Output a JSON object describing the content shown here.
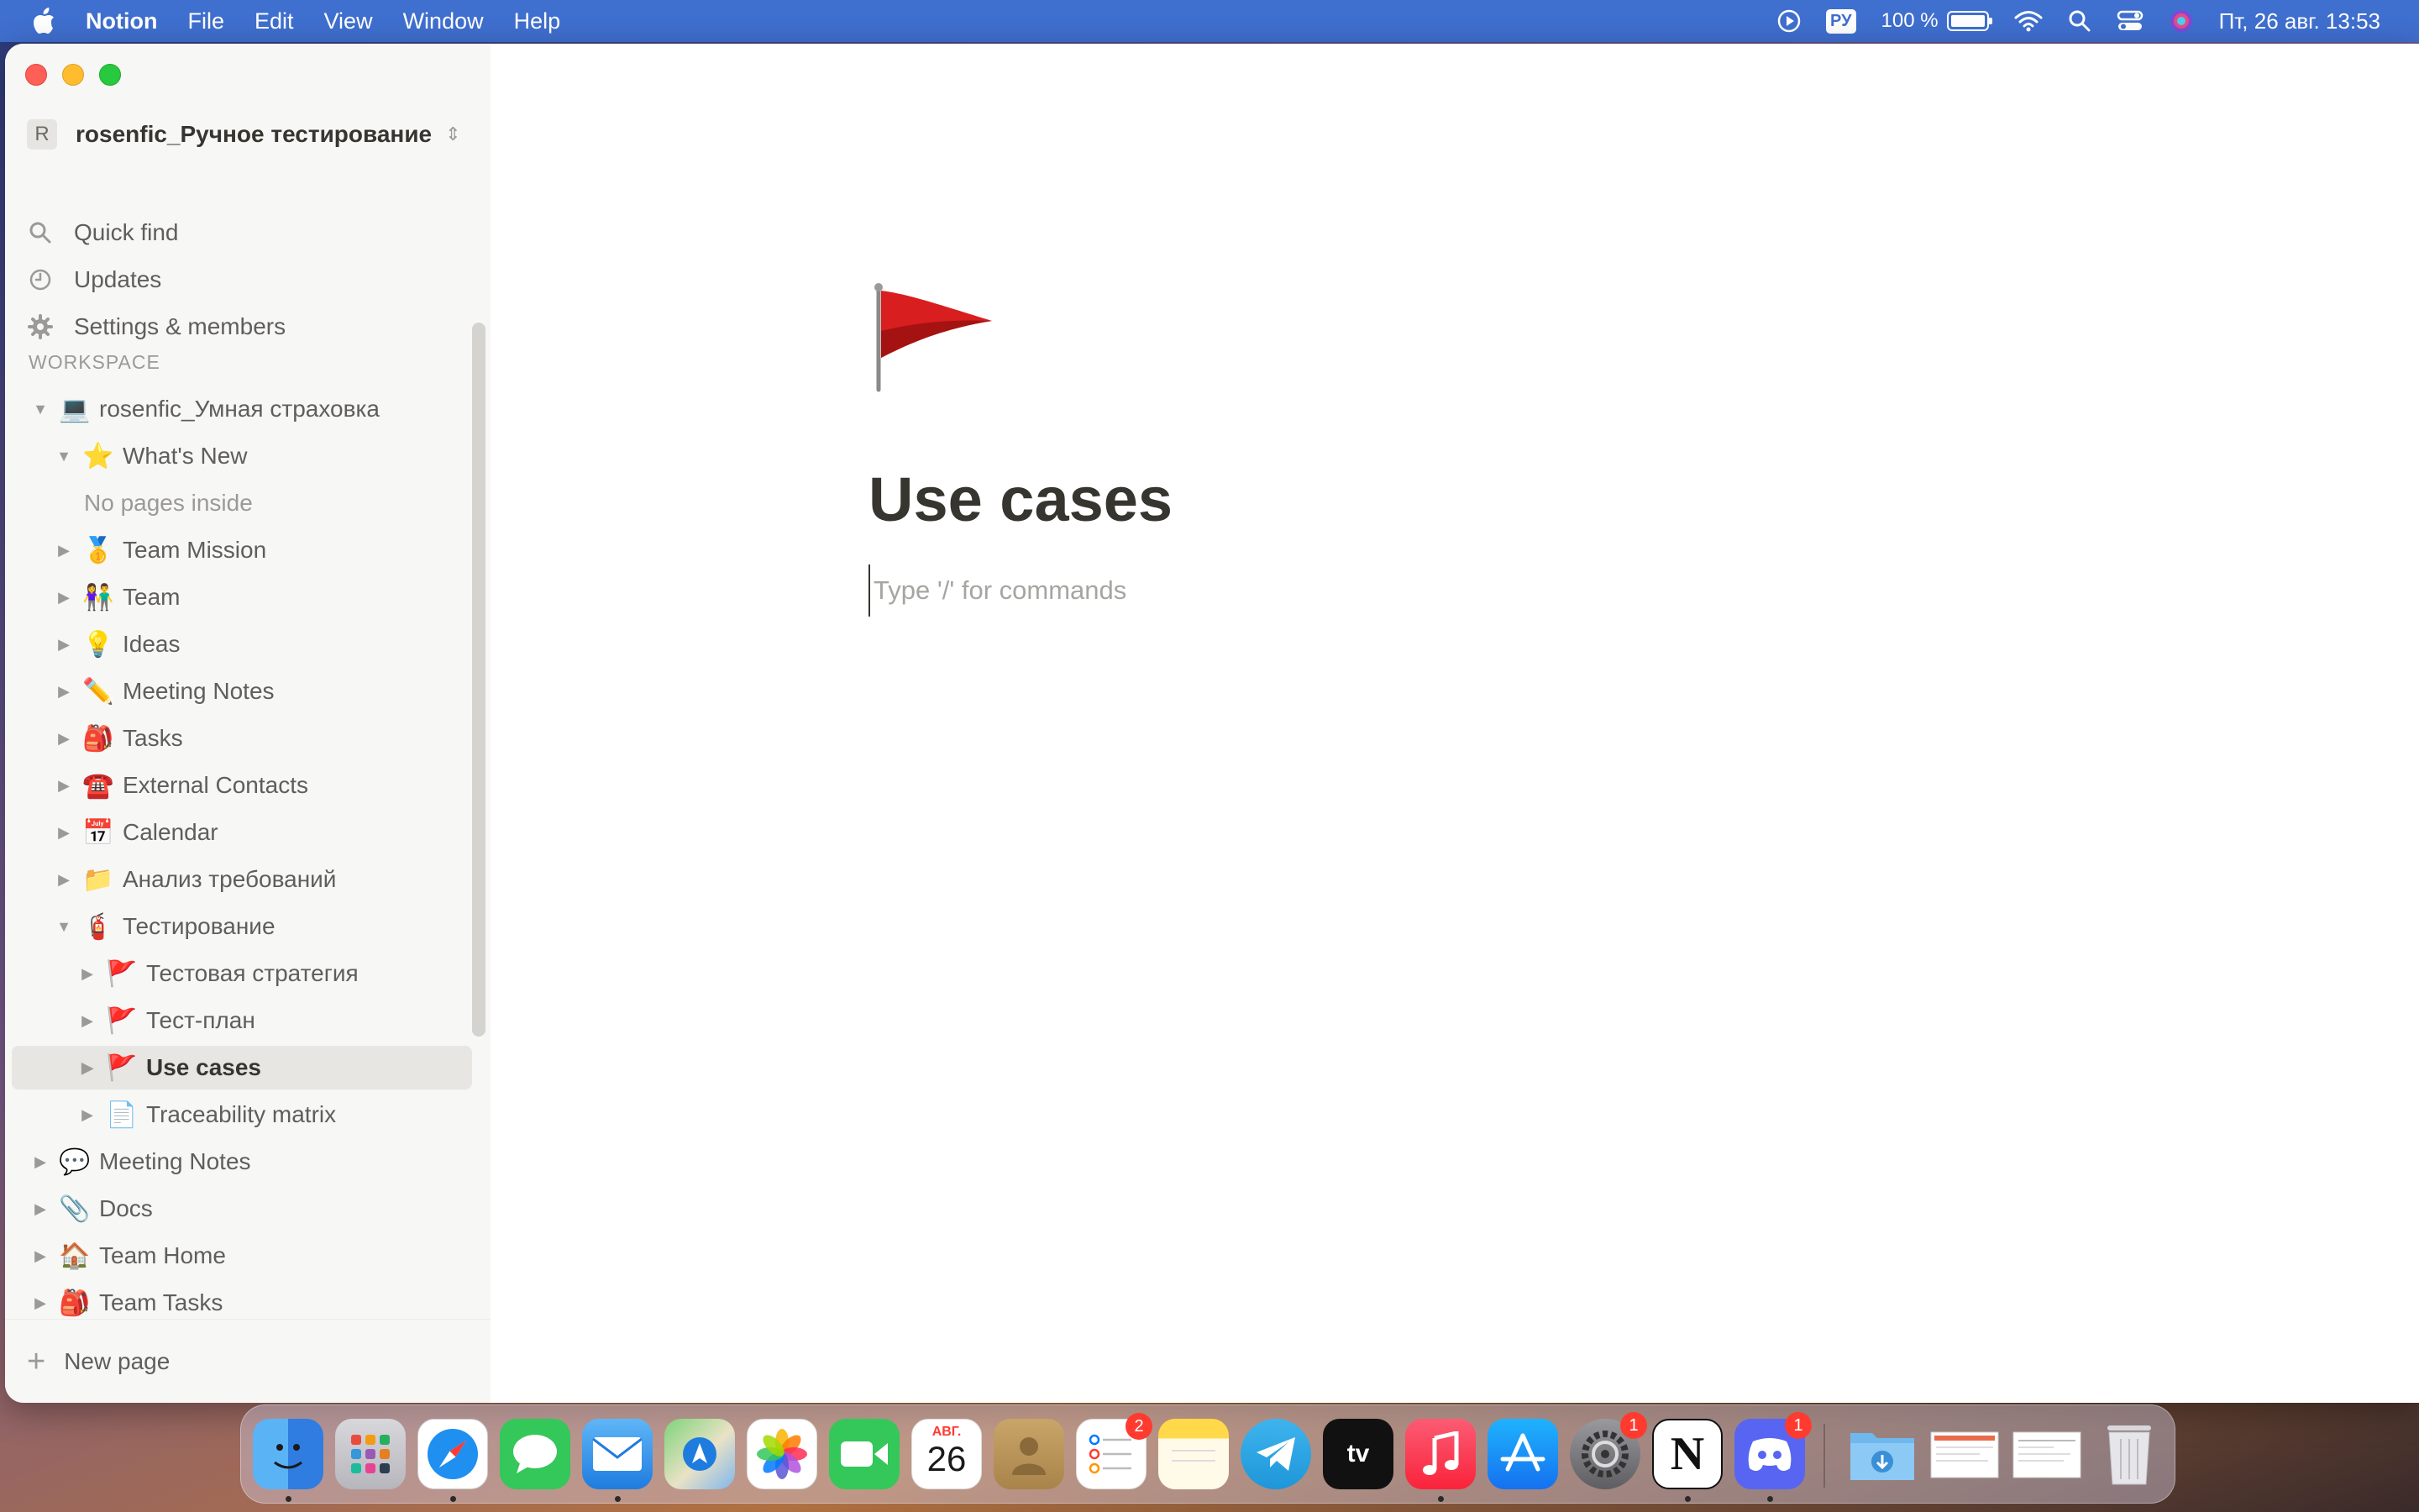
{
  "menubar": {
    "app_name": "Notion",
    "menus": [
      "File",
      "Edit",
      "View",
      "Window",
      "Help"
    ],
    "input_language": "РУ",
    "battery_percent": "100 %",
    "battery_level": 1.0,
    "clock": "Пт, 26 авг.  13:53"
  },
  "sidebar": {
    "workspace_avatar": "R",
    "workspace_name": "rosenfic_Ручное тестирование",
    "actions": [
      {
        "label": "Quick find",
        "icon": "search-icon"
      },
      {
        "label": "Updates",
        "icon": "clock-icon"
      },
      {
        "label": "Settings & members",
        "icon": "gear-icon"
      }
    ],
    "section_label": "WORKSPACE",
    "tree": [
      {
        "label": "rosenfic_Умная страховка",
        "emoji": "💻",
        "arrow": "▼"
      },
      {
        "label": "What's New",
        "emoji": "⭐",
        "arrow": "▼"
      },
      {
        "label": "No pages inside",
        "emoji": "",
        "arrow": ""
      },
      {
        "label": "Team Mission",
        "emoji": "🥇",
        "arrow": "▶"
      },
      {
        "label": "Team",
        "emoji": "👫",
        "arrow": "▶"
      },
      {
        "label": "Ideas",
        "emoji": "💡",
        "arrow": "▶"
      },
      {
        "label": "Meeting Notes",
        "emoji": "✏️",
        "arrow": "▶"
      },
      {
        "label": "Tasks",
        "emoji": "🎒",
        "arrow": "▶"
      },
      {
        "label": "External Contacts",
        "emoji": "☎️",
        "arrow": "▶"
      },
      {
        "label": "Calendar",
        "emoji": "📅",
        "arrow": "▶"
      },
      {
        "label": "Анализ требований",
        "emoji": "📁",
        "arrow": "▶"
      },
      {
        "label": "Тестирование",
        "emoji": "🧯",
        "arrow": "▼"
      },
      {
        "label": "Тестовая стратегия",
        "emoji": "🚩",
        "arrow": "▶"
      },
      {
        "label": "Тест-план",
        "emoji": "🚩",
        "arrow": "▶"
      },
      {
        "label": "Use cases",
        "emoji": "🚩",
        "arrow": "▶"
      },
      {
        "label": "Traceability matrix",
        "emoji": "📄",
        "arrow": "▶"
      },
      {
        "label": "Meeting Notes",
        "emoji": "💬",
        "arrow": "▶"
      },
      {
        "label": "Docs",
        "emoji": "📎",
        "arrow": "▶"
      },
      {
        "label": "Team Home",
        "emoji": "🏠",
        "arrow": "▶"
      },
      {
        "label": "Team Tasks",
        "emoji": "🎒",
        "arrow": "▶"
      }
    ],
    "new_page_label": "New page"
  },
  "page": {
    "icon": "red-flag-icon",
    "title": "Use cases",
    "placeholder": "Type '/' for commands"
  },
  "dock": {
    "apps": [
      {
        "name": "Finder",
        "badge": ""
      },
      {
        "name": "Launchpad",
        "badge": ""
      },
      {
        "name": "Safari",
        "badge": ""
      },
      {
        "name": "Messages",
        "badge": ""
      },
      {
        "name": "Mail",
        "badge": ""
      },
      {
        "name": "Maps",
        "badge": ""
      },
      {
        "name": "Photos",
        "badge": ""
      },
      {
        "name": "FaceTime",
        "badge": ""
      },
      {
        "name": "Calendar",
        "badge": "",
        "month": "АВГ.",
        "day": "26"
      },
      {
        "name": "Contacts",
        "badge": ""
      },
      {
        "name": "Reminders",
        "badge": "2"
      },
      {
        "name": "Notes",
        "badge": ""
      },
      {
        "name": "Telegram",
        "badge": ""
      },
      {
        "name": "TV",
        "badge": "",
        "glyph": "tv"
      },
      {
        "name": "Music",
        "badge": ""
      },
      {
        "name": "App Store",
        "badge": ""
      },
      {
        "name": "System Preferences",
        "badge": "1"
      },
      {
        "name": "Notion",
        "badge": "",
        "glyph": "N"
      },
      {
        "name": "Discord",
        "badge": "1"
      },
      {
        "name": "Downloads",
        "badge": ""
      },
      {
        "name": "Document 1",
        "badge": ""
      },
      {
        "name": "Document 2",
        "badge": ""
      },
      {
        "name": "Trash",
        "badge": ""
      }
    ]
  },
  "colors": {
    "menubar": "#3f6fcf",
    "sidebar": "#f7f7f5",
    "active_row": "#e7e6e3",
    "text": "#37352f"
  }
}
